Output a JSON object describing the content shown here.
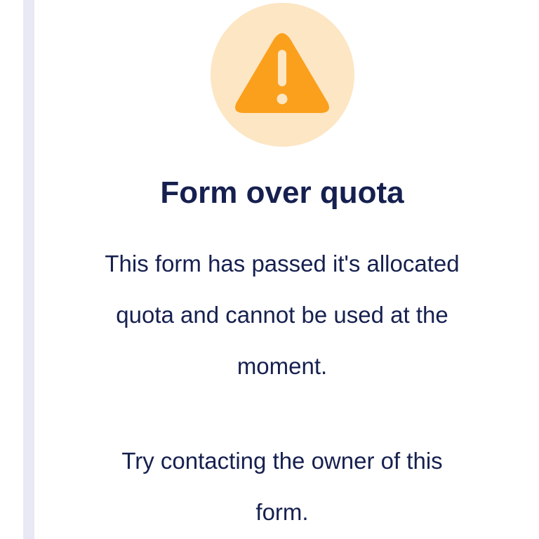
{
  "icon": {
    "name": "warning-icon",
    "circle_color": "#fde6c4",
    "triangle_color": "#fba01c",
    "mark_color": "#fde6c4"
  },
  "title": "Form over quota",
  "message": {
    "paragraph1": "This form has passed it's allocated quota and cannot be used at the moment.",
    "paragraph2": "Try contacting the owner of this form."
  },
  "colors": {
    "text": "#16204f",
    "rail": "#e8e9f4"
  }
}
